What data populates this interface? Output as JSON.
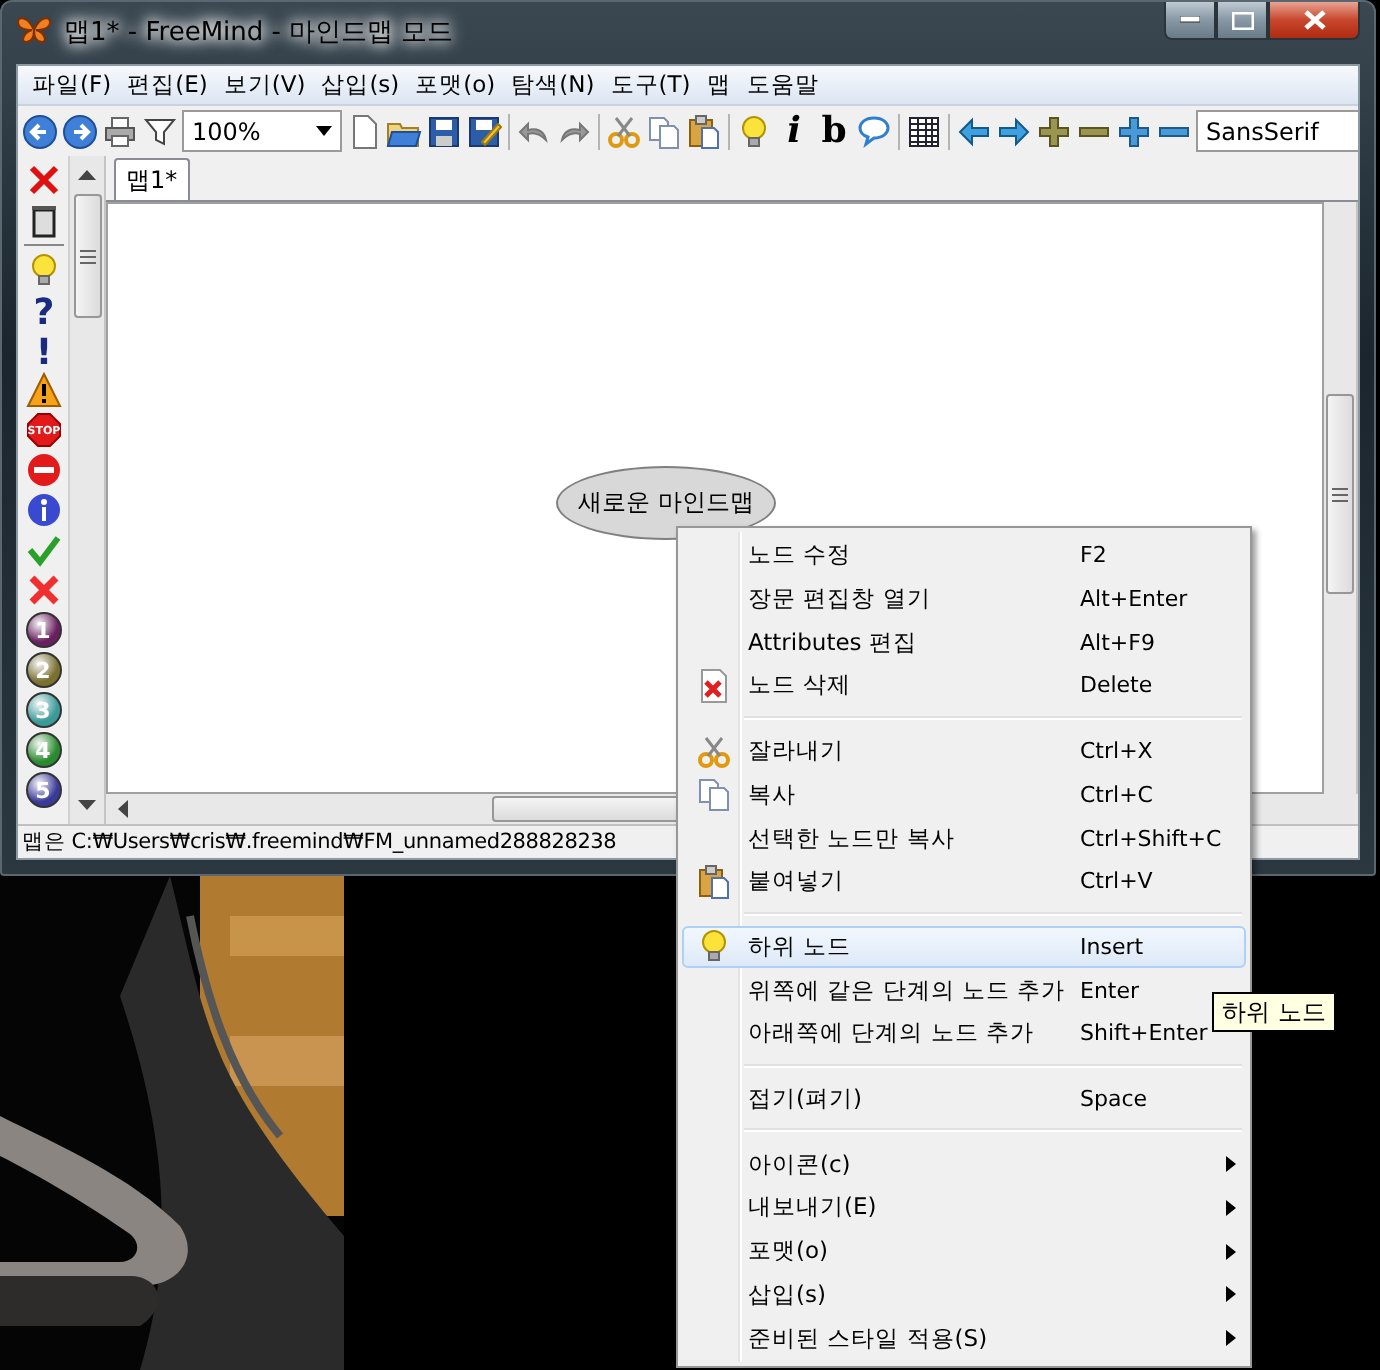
{
  "window": {
    "title": "맵1* - FreeMind - 마인드맵 모드"
  },
  "menu_bar": [
    "파일(F)",
    "편집(E)",
    "보기(V)",
    "삽입(s)",
    "포맷(o)",
    "탐색(N)",
    "도구(T)",
    "맵",
    "도움말"
  ],
  "toolbar": {
    "zoom": "100%",
    "italic_glyph": "i",
    "bold_glyph": "b",
    "font": "SansSerif"
  },
  "icon_palette": {
    "question_mark": "?",
    "exclamation_mark": "!",
    "stop_label": "STOP",
    "numbers": [
      "1",
      "2",
      "3",
      "4",
      "5"
    ]
  },
  "tabs": [
    {
      "label": "맵1*",
      "selected": true
    }
  ],
  "node": {
    "text": "새로운 마인드맵"
  },
  "status_bar": "맵은 C:₩Users₩cris₩.freemind₩FM_unnamed288828238",
  "context_menu": {
    "groups": [
      [
        {
          "label": "노드 수정",
          "shortcut": "F2",
          "submenu": false,
          "selected": false
        },
        {
          "label": "장문 편집창 열기",
          "shortcut": "Alt+Enter",
          "submenu": false,
          "selected": false
        },
        {
          "label": "Attributes 편집",
          "shortcut": "Alt+F9",
          "submenu": false,
          "selected": false
        },
        {
          "label": "노드 삭제",
          "shortcut": "Delete",
          "submenu": false,
          "selected": false
        }
      ],
      [
        {
          "label": "잘라내기",
          "shortcut": "Ctrl+X",
          "submenu": false,
          "selected": false
        },
        {
          "label": "복사",
          "shortcut": "Ctrl+C",
          "submenu": false,
          "selected": false
        },
        {
          "label": "선택한 노드만 복사",
          "shortcut": "Ctrl+Shift+C",
          "submenu": false,
          "selected": false
        },
        {
          "label": "붙여넣기",
          "shortcut": "Ctrl+V",
          "submenu": false,
          "selected": false
        }
      ],
      [
        {
          "label": "하위 노드",
          "shortcut": "Insert",
          "submenu": false,
          "selected": true
        },
        {
          "label": "위쪽에 같은 단계의 노드 추가",
          "shortcut": "Enter",
          "submenu": false,
          "selected": false
        },
        {
          "label": "아래쪽에 단계의 노드 추가",
          "shortcut": "Shift+Enter",
          "submenu": false,
          "selected": false
        }
      ],
      [
        {
          "label": "접기(펴기)",
          "shortcut": "Space",
          "submenu": false,
          "selected": false
        }
      ],
      [
        {
          "label": "아이콘(c)",
          "submenu": true,
          "selected": false
        },
        {
          "label": "내보내기(E)",
          "submenu": true,
          "selected": false
        },
        {
          "label": "포맷(o)",
          "submenu": true,
          "selected": false
        },
        {
          "label": "삽입(s)",
          "submenu": true,
          "selected": false
        },
        {
          "label": "준비된 스타일 적용(S)",
          "submenu": true,
          "selected": false
        }
      ]
    ]
  },
  "tooltip": "하위 노드"
}
